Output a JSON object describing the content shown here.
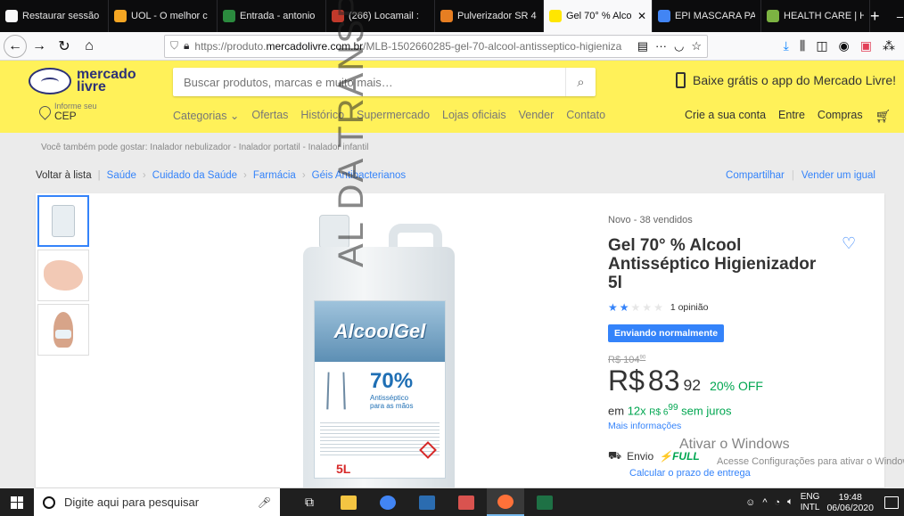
{
  "browser": {
    "tabs": [
      {
        "title": "Restaurar sessão",
        "color": "#f9f9fa",
        "icon": "warning-icon"
      },
      {
        "title": "UOL - O melhor c",
        "color": "#f5a623",
        "icon": "uol-icon"
      },
      {
        "title": "Entrada - antonio",
        "color": "#2b8a3e",
        "icon": "mail-icon"
      },
      {
        "title": "(266) Locamail :",
        "color": "#c0392b",
        "icon": "locaweb-icon"
      },
      {
        "title": "Pulverizador SR 4",
        "color": "#e67e22",
        "icon": "shop-icon"
      },
      {
        "title": "Gel 70° % Alco",
        "color": "#ffe600",
        "icon": "mercadolivre-icon",
        "active": true
      },
      {
        "title": "EPI MASCARA PA",
        "color": "#4285f4",
        "icon": "google-icon"
      },
      {
        "title": "HEALTH CARE | H",
        "color": "#7cb342",
        "icon": "leaf-icon"
      }
    ],
    "url_prefix": "https://produto.",
    "url_domain": "mercadolivre.com.br",
    "url_path": "/MLB-1502660285-gel-70-alcool-antisseptico-higieniza"
  },
  "header": {
    "logo_line1": "mercado",
    "logo_line2": "livre",
    "search_placeholder": "Buscar produtos, marcas e muito mais…",
    "app_banner": "Baixe grátis o app do Mercado Livre!",
    "cep_small": "Informe seu",
    "cep_big": "CEP",
    "categories": [
      "Categorias ⌄",
      "Ofertas",
      "Histórico",
      "Supermercado",
      "Lojas oficiais",
      "Vender",
      "Contato"
    ],
    "user_links": [
      "Crie a sua conta",
      "Entre",
      "Compras"
    ]
  },
  "page": {
    "related": "Você também pode gostar: Inalador nebulizador - Inalador portatil - Inalador infantil",
    "back_label": "Voltar à lista",
    "breadcrumbs": [
      "Saúde",
      "Cuidado da Saúde",
      "Farmácia",
      "Géis Antibacterianos"
    ],
    "share": "Compartilhar",
    "sell_same": "Vender um igual"
  },
  "product": {
    "condition": "Novo  -  38 vendidos",
    "title": "Gel 70° % Alcool Antisséptico Higienizador 5l",
    "rating_stars": 2,
    "rating_max": 5,
    "rating_text": "1 opinião",
    "badge": "Enviando normalmente",
    "old_price_int": "R$ 104",
    "old_price_cents": "90",
    "currency": "R$",
    "price_int": "83",
    "price_cents": "92",
    "discount": "20% OFF",
    "installments_prefix": "em",
    "installments": "12x",
    "installment_value": "R$ 6",
    "installment_cents": "99",
    "installments_suffix": "sem juros",
    "more_info": "Mais informações",
    "shipping_label": "Envio",
    "shipping_brand": "⚡FULL",
    "shipping_link": "Calcular o prazo de entrega",
    "label_brand": "AlcoolGel",
    "label_pct": "70%",
    "label_sub1": "Antisséptico",
    "label_sub2": "para as mãos",
    "label_volume": "5L"
  },
  "overlay": {
    "watermark": "AL DA TRANSPARE",
    "activate_title": "Ativar o Windows",
    "activate_sub": "Acesse Configurações para ativar o Windows."
  },
  "taskbar": {
    "search_text": "Digite aqui para pesquisar",
    "lang1": "ENG",
    "lang2": "INTL",
    "time": "19:48",
    "date": "06/06/2020"
  }
}
